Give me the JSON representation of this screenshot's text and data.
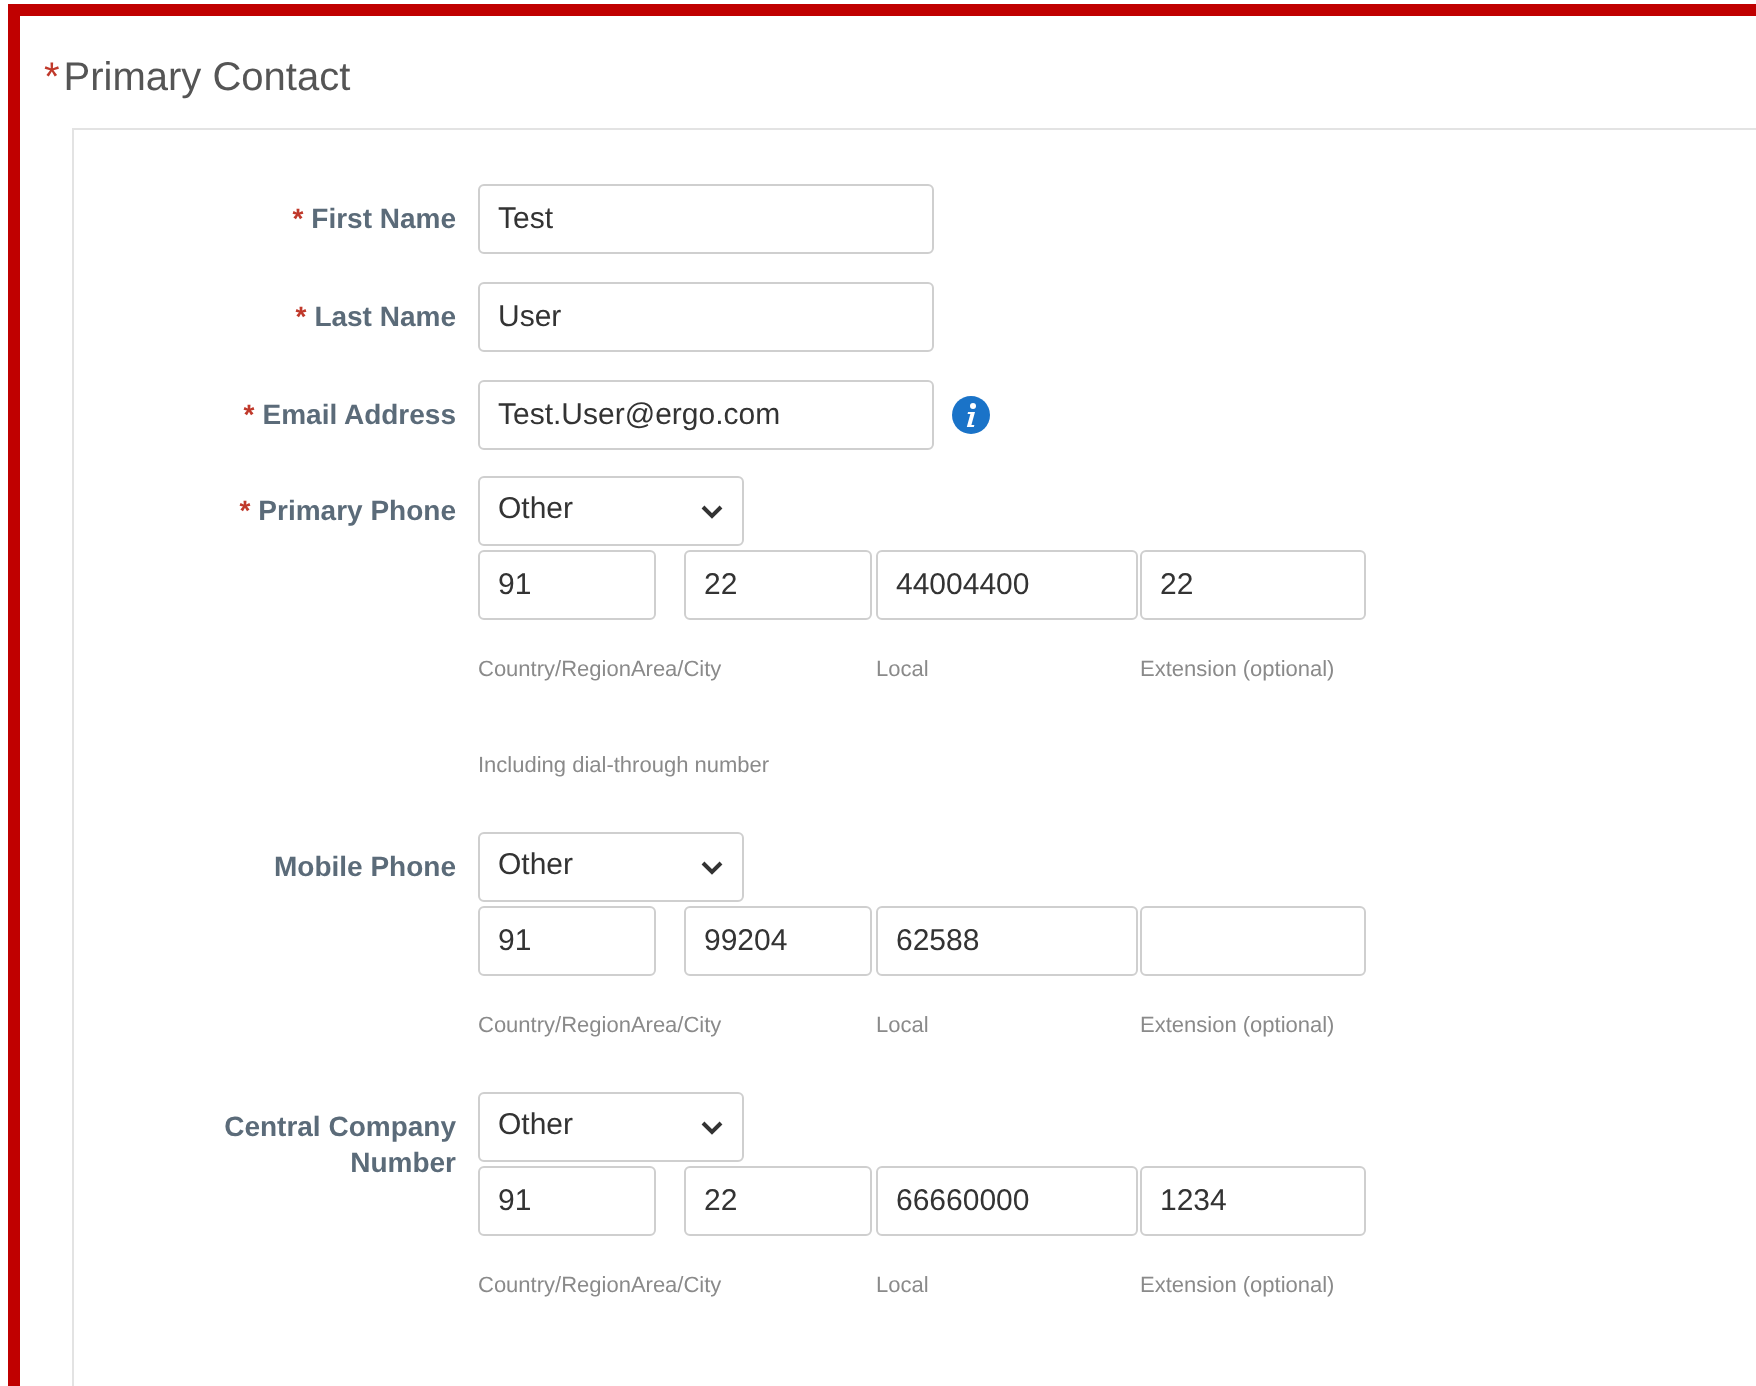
{
  "section": {
    "title": "Primary Contact",
    "marker": "*"
  },
  "fields": [
    {
      "label": "First Name",
      "marker": "*",
      "value": "Test"
    },
    {
      "label": "Last Name",
      "marker": "*",
      "value": "User"
    },
    {
      "label": "Email Address",
      "marker": "*",
      "value": "Test.User@ergo.com",
      "info": true
    }
  ],
  "phones": [
    {
      "label": "Primary Phone",
      "marker": "*",
      "type": "Other",
      "parts": [
        {
          "caption": "Country/Region",
          "value": "91"
        },
        {
          "caption": "Area/City",
          "value": "22"
        },
        {
          "caption": "Local",
          "value": "44004400"
        },
        {
          "caption": "Extension (optional)",
          "value": "22"
        }
      ],
      "note": "Including dial-through number"
    },
    {
      "label": "Mobile Phone",
      "type": "Other",
      "parts": [
        {
          "caption": "Country/Region",
          "value": "91"
        },
        {
          "caption": "Area/City",
          "value": "99204"
        },
        {
          "caption": "Local",
          "value": "62588"
        },
        {
          "caption": "Extension (optional)"
        }
      ]
    },
    {
      "label": "Central Company Number",
      "type": "Other",
      "parts": [
        {
          "caption": "Country/Region",
          "value": "91"
        },
        {
          "caption": "Area/City",
          "value": "22"
        },
        {
          "caption": "Local",
          "value": "66660000"
        },
        {
          "caption": "Extension (optional)",
          "value": "1234"
        }
      ]
    }
  ]
}
